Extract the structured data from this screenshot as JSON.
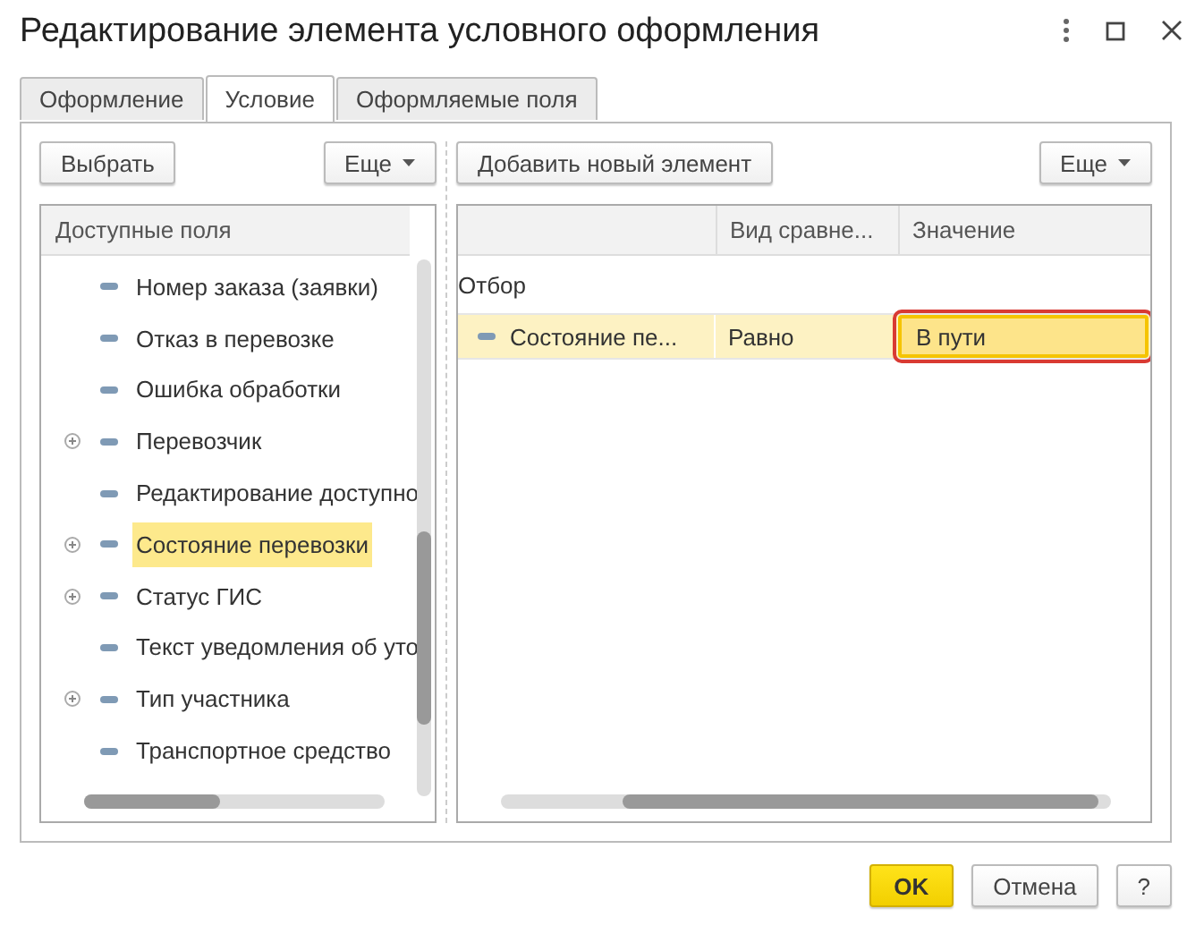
{
  "window": {
    "title": "Редактирование элемента условного оформления"
  },
  "tabs": [
    {
      "label": "Оформление",
      "selected": false
    },
    {
      "label": "Условие",
      "selected": true
    },
    {
      "label": "Оформляемые поля",
      "selected": false
    }
  ],
  "left_toolbar": {
    "select_button": "Выбрать",
    "more_button": "Еще"
  },
  "fields_tree": {
    "header": "Доступные поля",
    "items": [
      {
        "label": "Номер заказа (заявки)",
        "expandable": false,
        "selected": false
      },
      {
        "label": "Отказ в перевозке",
        "expandable": false,
        "selected": false
      },
      {
        "label": "Ошибка обработки",
        "expandable": false,
        "selected": false
      },
      {
        "label": "Перевозчик",
        "expandable": true,
        "selected": false
      },
      {
        "label": "Редактирование доступно",
        "expandable": false,
        "selected": false
      },
      {
        "label": "Состояние перевозки",
        "expandable": true,
        "selected": true
      },
      {
        "label": "Статус ГИС",
        "expandable": true,
        "selected": false
      },
      {
        "label": "Текст уведомления об уто",
        "expandable": false,
        "selected": false
      },
      {
        "label": "Тип участника",
        "expandable": true,
        "selected": false
      },
      {
        "label": "Транспортное средство",
        "expandable": false,
        "selected": false
      }
    ]
  },
  "right_toolbar": {
    "add_button": "Добавить новый элемент",
    "more_button": "Еще"
  },
  "filter_table": {
    "columns": [
      "Вид сравне...",
      "Значение"
    ],
    "rows": [
      {
        "kind": "group",
        "field": "Отбор"
      },
      {
        "kind": "condition",
        "field": "Состояние пе...",
        "comparison": "Равно",
        "value": "В пути",
        "highlighted": true
      }
    ]
  },
  "buttons": {
    "ok": "OK",
    "cancel": "Отмена",
    "help": "?"
  }
}
